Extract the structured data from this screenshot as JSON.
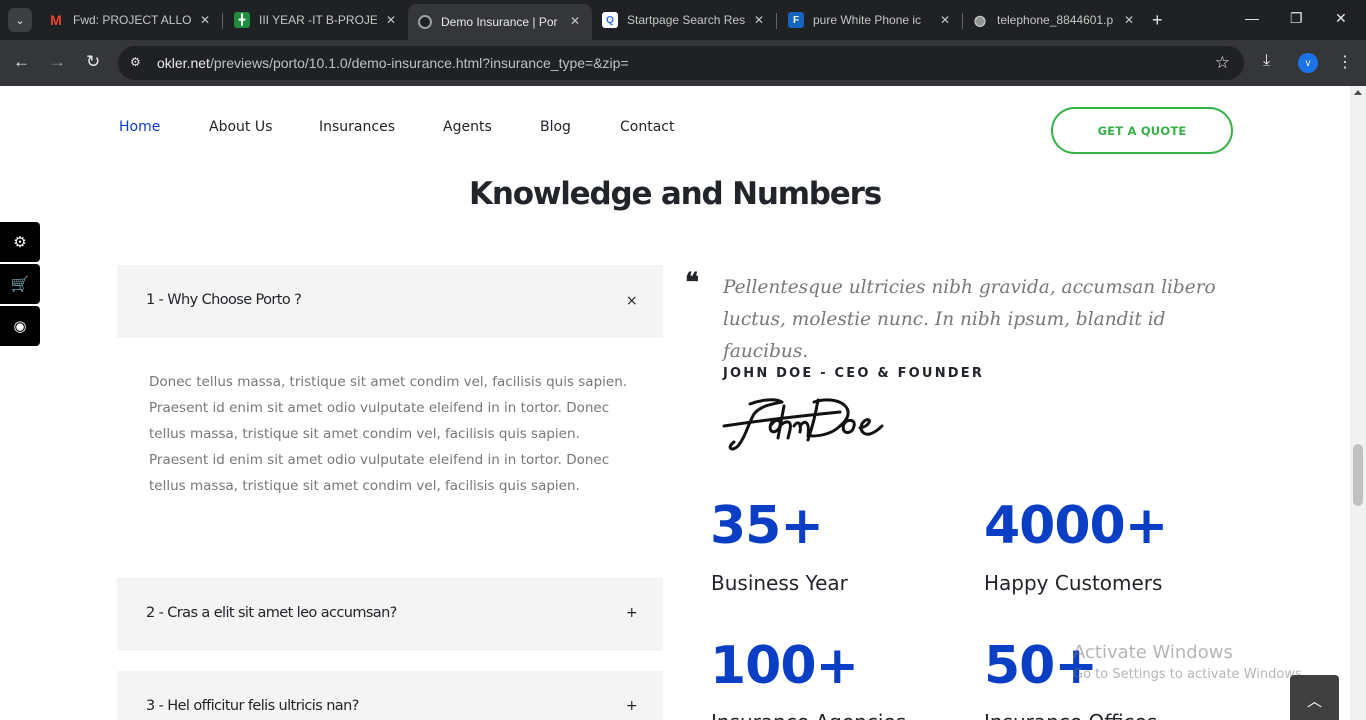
{
  "browser": {
    "tabs": [
      {
        "title": "Fwd: PROJECT ALLOC",
        "icon": "gmail-icon",
        "color": "#ea4335"
      },
      {
        "title": "III YEAR -IT B-PROJEC",
        "icon": "sheets-icon",
        "color": "#1e8e3e"
      },
      {
        "title": "Demo Insurance | Por",
        "icon": "porto-icon",
        "color": "#5f6368",
        "active": true
      },
      {
        "title": "Startpage Search Res",
        "icon": "startpage-icon",
        "color": "#2d6ae3"
      },
      {
        "title": "pure White Phone ic",
        "icon": "flaticon-icon",
        "color": "#1565c0"
      },
      {
        "title": "telephone_8844601.p",
        "icon": "globe-icon",
        "color": "#9aa0a6"
      }
    ],
    "url_host": "okler.net",
    "url_path": "/previews/porto/10.1.0/demo-insurance.html?insurance_type=&zip=",
    "profile_initial": "v"
  },
  "nav": {
    "items": [
      "Home",
      "About Us",
      "Insurances",
      "Agents",
      "Blog",
      "Contact"
    ],
    "cta": "GET A QUOTE"
  },
  "section": {
    "heading_light": "Knowledge and ",
    "heading_bold": "Numbers"
  },
  "accordion": {
    "items": [
      {
        "title": "1 - Why Choose Porto ?",
        "symbol": "×"
      },
      {
        "title": "2 - Cras a elit sit amet leo accumsan?",
        "symbol": "+"
      },
      {
        "title": "3 - Hel officitur felis ultricis nan?",
        "symbol": "+"
      }
    ],
    "body": "Donec tellus massa, tristique sit amet condim vel, facilisis quis sapien. Praesent id enim sit amet odio vulputate eleifend in in tortor. Donec tellus massa, tristique sit amet condim vel, facilisis quis sapien. Praesent id enim sit amet odio vulputate eleifend in in tortor. Donec tellus massa, tristique sit amet condim vel, facilisis quis sapien."
  },
  "testimonial": {
    "quote": "Pellentesque ultricies nibh gravida, accumsan libero luctus, molestie nunc. In nibh ipsum, blandit id faucibus.",
    "author": "JOHN DOE - CEO & FOUNDER",
    "signature": "John Doe"
  },
  "stats": [
    {
      "number": "35+",
      "label": "Business Year"
    },
    {
      "number": "4000+",
      "label": "Happy Customers"
    },
    {
      "number": "100+",
      "label": "Insurance Agencies"
    },
    {
      "number": "50+",
      "label": "Insurance Offices"
    }
  ],
  "watermark": {
    "line1": "Activate Windows",
    "line2": "Go to Settings to activate Windows."
  },
  "colors": {
    "brand_blue": "#0a3ec4",
    "cta_green": "#36b047"
  }
}
